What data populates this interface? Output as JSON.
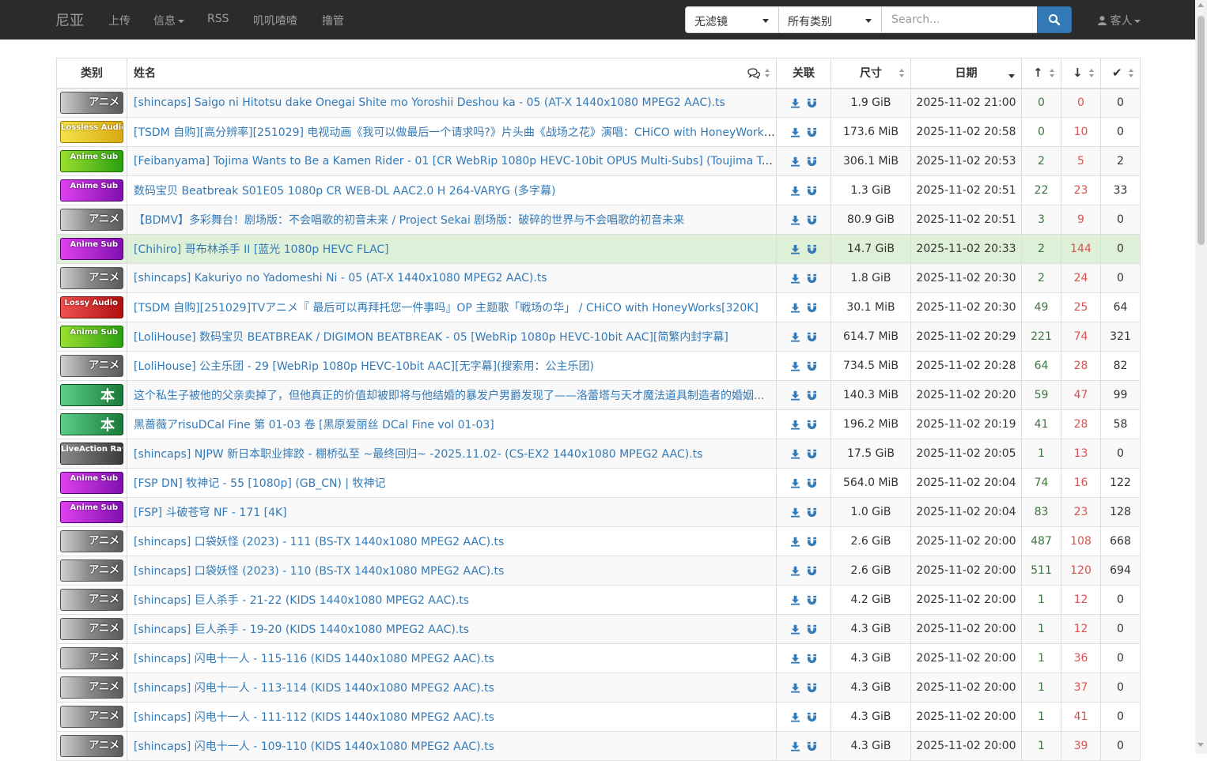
{
  "nav": {
    "brand": "尼亚",
    "items": [
      "上传",
      "信息",
      "RSS",
      "叽叽喳喳",
      "撸管"
    ],
    "filter_select": "无滤镜",
    "category_select": "所有类别",
    "search_placeholder": "Search...",
    "user": "客人"
  },
  "table": {
    "headers": {
      "category": "类别",
      "name": "姓名",
      "links": "关联",
      "size": "尺寸",
      "date": "日期",
      "seeders": "↑",
      "leechers": "↓",
      "completed": "✔"
    },
    "rows": [
      {
        "category": "アニメ",
        "badge": "anime",
        "name": "[shincaps] Saigo ni Hitotsu dake Onegai Shite mo Yoroshii Deshou ka - 05 (AT-X 1440x1080 MPEG2 AAC).ts",
        "size": "1.9 GiB",
        "date": "2025-11-02 21:00",
        "seeders": "0",
        "leechers": "0",
        "completed": "0"
      },
      {
        "category": "Lossless Audio",
        "badge": "lossless",
        "name": "[TSDM 自购][高分辨率][251029] 电视动画《我可以做最后一个请求吗?》片头曲《战场之花》演唱：CHiCO with HoneyWorks [...",
        "size": "173.6 MiB",
        "date": "2025-11-02 20:58",
        "seeders": "0",
        "leechers": "10",
        "completed": "0"
      },
      {
        "category": "Anime Sub",
        "badge": "sub-green",
        "name": "[Feibanyama] Tojima Wants to Be a Kamen Rider - 01 [CR WebRip 1080p HEVC-10bit OPUS Multi-Subs] (Toujima Tanzaburou...",
        "size": "306.1 MiB",
        "date": "2025-11-02 20:53",
        "seeders": "2",
        "leechers": "5",
        "completed": "2"
      },
      {
        "category": "Anime Sub",
        "badge": "sub-purple",
        "name": "数码宝贝 Beatbreak S01E05 1080p CR WEB-DL AAC2.0 H 264-VARYG (多字幕)",
        "size": "1.3 GiB",
        "date": "2025-11-02 20:51",
        "seeders": "22",
        "leechers": "23",
        "completed": "33"
      },
      {
        "category": "アニメ",
        "badge": "anime",
        "name": "【BDMV】多彩舞台！剧场版：不会唱歌的初音未来 / Project Sekai 剧场版：破碎的世界与不会唱歌的初音未来",
        "size": "80.9 GiB",
        "date": "2025-11-02 20:51",
        "seeders": "3",
        "leechers": "9",
        "completed": "0"
      },
      {
        "category": "Anime Sub",
        "badge": "sub-purple",
        "name": "[Chihiro] 哥布林杀手 II [蓝光 1080p HEVC FLAC]",
        "size": "14.7 GiB",
        "date": "2025-11-02 20:33",
        "seeders": "2",
        "leechers": "144",
        "completed": "0"
      },
      {
        "category": "アニメ",
        "badge": "anime",
        "name": "[shincaps] Kakuriyo no Yadomeshi Ni - 05 (AT-X 1440x1080 MPEG2 AAC).ts",
        "size": "1.8 GiB",
        "date": "2025-11-02 20:30",
        "seeders": "2",
        "leechers": "24",
        "completed": "0"
      },
      {
        "category": "Lossy Audio",
        "badge": "lossy",
        "name": "[TSDM 自购][251029]TVアニメ『 最后可以再拜托您一件事吗』OP 主题歌「戦场の华」 / CHiCO with HoneyWorks[320K]",
        "size": "30.1 MiB",
        "date": "2025-11-02 20:30",
        "seeders": "49",
        "leechers": "25",
        "completed": "64"
      },
      {
        "category": "Anime Sub",
        "badge": "sub-green",
        "name": "[LoliHouse] 数码宝贝 BEATBREAK / DIGIMON BEATBREAK - 05 [WebRip 1080p HEVC-10bit AAC][简繁内封字幕]",
        "size": "614.7 MiB",
        "date": "2025-11-02 20:29",
        "seeders": "221",
        "leechers": "74",
        "completed": "321"
      },
      {
        "category": "アニメ",
        "badge": "anime",
        "name": "[LoliHouse] 公主乐团 - 29 [WebRip 1080p HEVC-10bit AAC][无字幕](搜索用：公主乐团)",
        "size": "734.5 MiB",
        "date": "2025-11-02 20:28",
        "seeders": "64",
        "leechers": "28",
        "completed": "82"
      },
      {
        "category": "本",
        "badge": "book",
        "name": "这个私生子被他的父亲卖掉了，但他真正的价值却被即将与他结婚的暴发户男爵发现了——洛蕾塔与天才魔法道具制造者的婚姻...",
        "size": "140.3 MiB",
        "date": "2025-11-02 20:20",
        "seeders": "59",
        "leechers": "47",
        "completed": "99"
      },
      {
        "category": "本",
        "badge": "book",
        "name": "黑蔷薇アrisuDCal Fine 第 01-03 卷 [黑原爱丽丝 DCal Fine vol 01-03]",
        "size": "196.2 MiB",
        "date": "2025-11-02 20:19",
        "seeders": "41",
        "leechers": "28",
        "completed": "58"
      },
      {
        "category": "LiveAction Raw",
        "badge": "raw",
        "name": "[shincaps] NJPW 新日本职业摔跤 - 棚桥弘至 ~最终回归~ -2025.11.02- (CS-EX2 1440x1080 MPEG2 AAC).ts",
        "size": "17.5 GiB",
        "date": "2025-11-02 20:05",
        "seeders": "1",
        "leechers": "13",
        "completed": "0"
      },
      {
        "category": "Anime Sub",
        "badge": "sub-purple",
        "name": "[FSP DN] 牧神记 - 55 [1080p] (GB_CN) | 牧神记",
        "size": "564.0 MiB",
        "date": "2025-11-02 20:04",
        "seeders": "74",
        "leechers": "16",
        "completed": "122"
      },
      {
        "category": "Anime Sub",
        "badge": "sub-purple",
        "name": "[FSP] 斗破苍穹 NF - 171 [4K]",
        "size": "1.0 GiB",
        "date": "2025-11-02 20:04",
        "seeders": "83",
        "leechers": "23",
        "completed": "128"
      },
      {
        "category": "アニメ",
        "badge": "anime",
        "name": "[shincaps] 口袋妖怪 (2023) - 111 (BS-TX 1440x1080 MPEG2 AAC).ts",
        "size": "2.6 GiB",
        "date": "2025-11-02 20:00",
        "seeders": "487",
        "leechers": "108",
        "completed": "668"
      },
      {
        "category": "アニメ",
        "badge": "anime",
        "name": "[shincaps] 口袋妖怪 (2023) - 110 (BS-TX 1440x1080 MPEG2 AAC).ts",
        "size": "2.6 GiB",
        "date": "2025-11-02 20:00",
        "seeders": "511",
        "leechers": "120",
        "completed": "694"
      },
      {
        "category": "アニメ",
        "badge": "anime",
        "name": "[shincaps] 巨人杀手 - 21-22 (KIDS 1440x1080 MPEG2 AAC).ts",
        "size": "4.2 GiB",
        "date": "2025-11-02 20:00",
        "seeders": "1",
        "leechers": "12",
        "completed": "0"
      },
      {
        "category": "アニメ",
        "badge": "anime",
        "name": "[shincaps] 巨人杀手 - 19-20 (KIDS 1440x1080 MPEG2 AAC).ts",
        "size": "4.3 GiB",
        "date": "2025-11-02 20:00",
        "seeders": "1",
        "leechers": "12",
        "completed": "0"
      },
      {
        "category": "アニメ",
        "badge": "anime",
        "name": "[shincaps] 闪电十一人 - 115-116 (KIDS 1440x1080 MPEG2 AAC).ts",
        "size": "4.3 GiB",
        "date": "2025-11-02 20:00",
        "seeders": "1",
        "leechers": "36",
        "completed": "0"
      },
      {
        "category": "アニメ",
        "badge": "anime",
        "name": "[shincaps] 闪电十一人 - 113-114 (KIDS 1440x1080 MPEG2 AAC).ts",
        "size": "4.3 GiB",
        "date": "2025-11-02 20:00",
        "seeders": "1",
        "leechers": "37",
        "completed": "0"
      },
      {
        "category": "アニメ",
        "badge": "anime",
        "name": "[shincaps] 闪电十一人 - 111-112 (KIDS 1440x1080 MPEG2 AAC).ts",
        "size": "4.3 GiB",
        "date": "2025-11-02 20:00",
        "seeders": "1",
        "leechers": "41",
        "completed": "0"
      },
      {
        "category": "アニメ",
        "badge": "anime",
        "name": "[shincaps] 闪电十一人 - 109-110 (KIDS 1440x1080 MPEG2 AAC).ts",
        "size": "4.3 GiB",
        "date": "2025-11-02 20:00",
        "seeders": "1",
        "leechers": "39",
        "completed": "0"
      }
    ]
  },
  "colors": {
    "navbar": "#2b2b2b",
    "link": "#337ab7",
    "seeders": "#3c763d",
    "leechers": "#d9534f",
    "highlight_row": "#dff0d8"
  },
  "icons": {
    "download": "download-icon",
    "magnet": "magnet-icon",
    "search": "search-icon",
    "user": "user-icon",
    "comments": "comments-icon"
  }
}
